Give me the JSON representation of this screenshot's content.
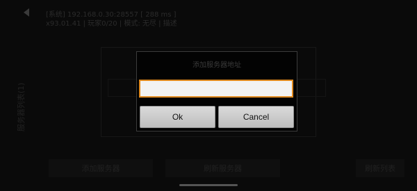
{
  "background": {
    "info_line1": "[系统] 192.168.0.30:28557 [ 288 ms ]",
    "info_line2": "x93.01.41 | 玩家0/20 | 模式: 无尽 | 描述",
    "side_label": "服务器列表(1)",
    "buttons": [
      "添加服务器",
      "刷新服务器",
      "刷新列表"
    ]
  },
  "dialog": {
    "title": "添加服务器地址",
    "input_value": "",
    "input_placeholder": "",
    "ok_label": "Ok",
    "cancel_label": "Cancel"
  },
  "colors": {
    "input_border": "#e08a1e",
    "button_face": "#d0d0d0",
    "dialog_bg": "#030303"
  }
}
